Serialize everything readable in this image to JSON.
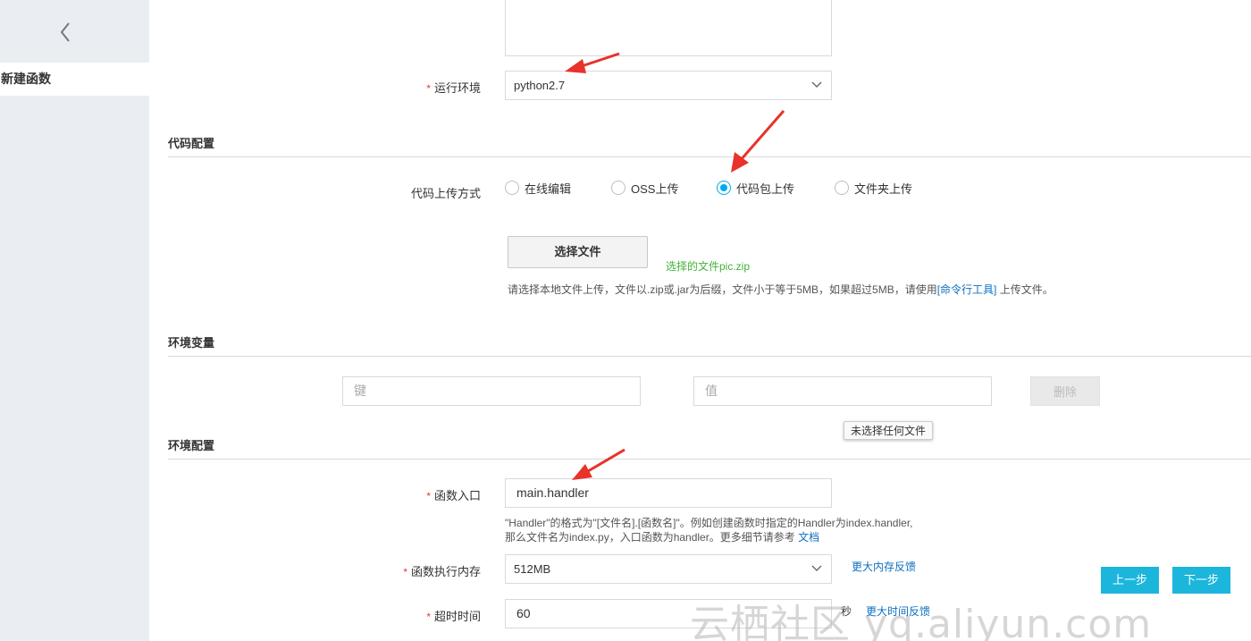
{
  "sidebar": {
    "back_icon": "chevron-left-icon",
    "active_item": "新建函数"
  },
  "runtime": {
    "label": "运行环境",
    "required_mark": "*",
    "value": "python2.7"
  },
  "code_config": {
    "title": "代码配置",
    "upload_label": "代码上传方式",
    "options": [
      "在线编辑",
      "OSS上传",
      "代码包上传",
      "文件夹上传"
    ],
    "selected": "代码包上传",
    "file_button": "选择文件",
    "file_chosen": "选择的文件pic.zip",
    "hint_before": "请选择本地文件上传，文件以.zip或.jar为后缀，文件小于等于5MB，如果超过5MB，请使用",
    "hint_link": "[命令行工具]",
    "hint_after": " 上传文件。"
  },
  "env_vars": {
    "title": "环境变量",
    "key_placeholder": "键",
    "value_placeholder": "值",
    "delete_button": "删除",
    "tooltip": "未选择任何文件"
  },
  "env_config": {
    "title": "环境配置",
    "handler_label": "函数入口",
    "handler_value": "main.handler",
    "handler_hint_line1": "\"Handler\"的格式为\"[文件名].[函数名]\"。例如创建函数时指定的Handler为index.handler,",
    "handler_hint_line2": "那么文件名为index.py，入口函数为handler。更多细节请参考 ",
    "handler_hint_link": "文档",
    "memory_label": "函数执行内存",
    "memory_value": "512MB",
    "memory_link": "更大内存反馈",
    "timeout_label": "超时时间",
    "timeout_value": "60",
    "timeout_unit": "秒",
    "timeout_link": "更大时间反馈"
  },
  "nav": {
    "prev": "上一步",
    "next": "下一步"
  },
  "watermark": "云栖社区 yq.aliyun.com",
  "colors": {
    "accent": "#1cb6dc",
    "radio_active": "#00aaee",
    "required": "#e4393c",
    "link": "#0d6fc1",
    "success": "#41b337",
    "annotation_arrow": "#e8322a"
  }
}
